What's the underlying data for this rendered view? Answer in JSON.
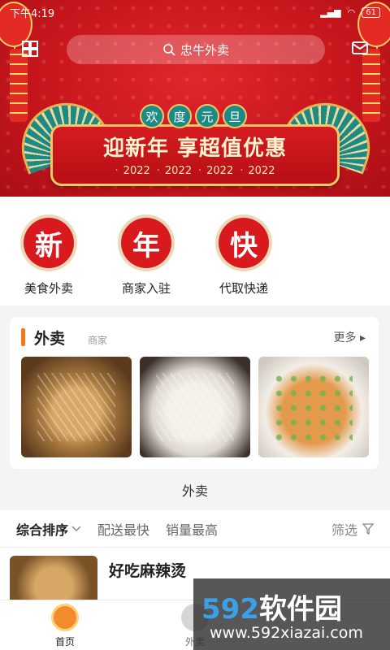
{
  "status_bar": {
    "time": "下午4:19",
    "battery": "61"
  },
  "search": {
    "placeholder": "忠牛外卖"
  },
  "banner": {
    "badges": [
      "欢",
      "度",
      "元",
      "旦"
    ],
    "headline": "迎新年 享超值优惠",
    "years": [
      "2022",
      "2022",
      "2022",
      "2022"
    ]
  },
  "quick_entries": [
    {
      "glyph": "新",
      "label": "美食外卖"
    },
    {
      "glyph": "年",
      "label": "商家入驻"
    },
    {
      "glyph": "快",
      "label": "代取快递"
    }
  ],
  "takeout_card": {
    "title": "外卖",
    "subtitle": "商家",
    "more": "更多 ▸"
  },
  "section_caption": "外卖",
  "sort_bar": {
    "options": [
      "综合排序",
      "配送最快",
      "销量最高"
    ],
    "filter": "筛选"
  },
  "list": [
    {
      "name": "好吃麻辣烫"
    }
  ],
  "bottom_nav": [
    {
      "label": "首页",
      "active": true
    },
    {
      "label": "外卖",
      "active": false
    }
  ],
  "watermark": {
    "big_num": "592",
    "big_text": "软件园",
    "url": "www.592xiazai.com"
  },
  "colors": {
    "accent": "#f27a1a",
    "banner_red": "#c8161d",
    "seal_red": "#d8191e"
  }
}
